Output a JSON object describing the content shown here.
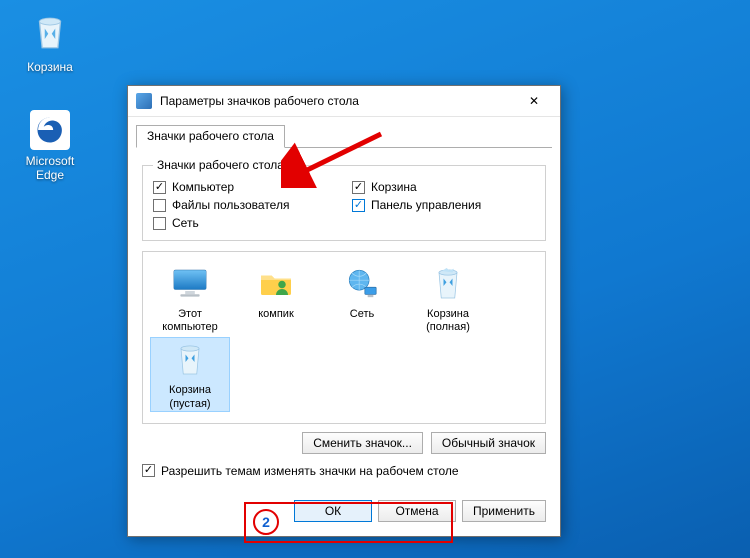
{
  "desktop": {
    "icons": [
      {
        "name": "recycle-bin",
        "label": "Корзина"
      },
      {
        "name": "edge",
        "label": "Microsoft Edge"
      }
    ]
  },
  "dialog": {
    "title": "Параметры значков рабочего стола",
    "tab": "Значки рабочего стола",
    "group_legend": "Значки рабочего стола",
    "checks": {
      "computer": {
        "label": "Компьютер",
        "checked": true,
        "blue": false
      },
      "userfiles": {
        "label": "Файлы пользователя",
        "checked": false
      },
      "network": {
        "label": "Сеть",
        "checked": false
      },
      "recycle": {
        "label": "Корзина",
        "checked": true,
        "blue": false
      },
      "cpanel": {
        "label": "Панель управления",
        "checked": true,
        "blue": true
      }
    },
    "icons": [
      {
        "key": "this_pc",
        "label": "Этот компьютер",
        "sel": false,
        "type": "monitor"
      },
      {
        "key": "kompik",
        "label": "компик",
        "sel": false,
        "type": "folder"
      },
      {
        "key": "net",
        "label": "Сеть",
        "sel": false,
        "type": "globe"
      },
      {
        "key": "bin_full",
        "label": "Корзина (полная)",
        "sel": false,
        "type": "binfull"
      },
      {
        "key": "bin_empty",
        "label": "Корзина (пустая)",
        "sel": true,
        "type": "binempty"
      }
    ],
    "btn_change": "Сменить значок...",
    "btn_default": "Обычный значок",
    "allow_themes": {
      "label": "Разрешить темам изменять значки на рабочем столе",
      "checked": true
    },
    "ok": "ОК",
    "cancel": "Отмена",
    "apply": "Применить"
  },
  "annotation": {
    "step": "2"
  }
}
